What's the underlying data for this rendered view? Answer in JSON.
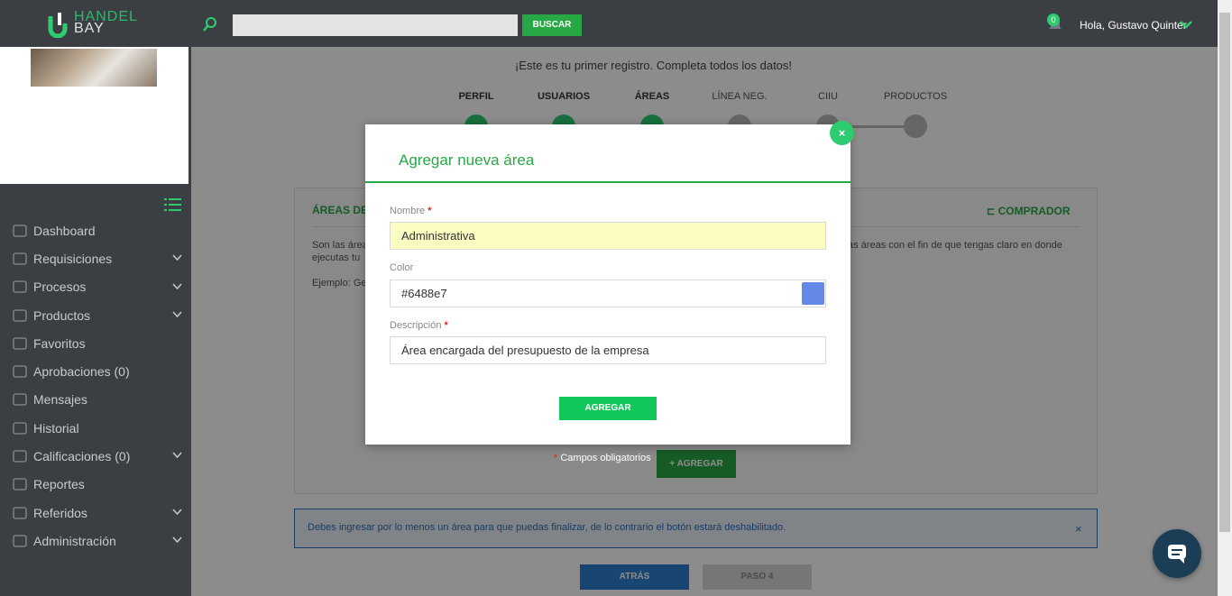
{
  "topbar": {
    "logo_text_1": "HANDEL",
    "logo_text_2": "BAY",
    "search_placeholder": "",
    "search_button": "BUSCAR",
    "notifications_count": "0",
    "greeting": "Hola, Gustavo Quinter"
  },
  "sidebar": {
    "items": [
      {
        "label": "Dashboard",
        "icon": "home-icon",
        "has_submenu": false
      },
      {
        "label": "Requisiciones",
        "icon": "clipboard-icon",
        "has_submenu": true
      },
      {
        "label": "Procesos",
        "icon": "basket-icon",
        "has_submenu": true
      },
      {
        "label": "Productos",
        "icon": "box-icon",
        "has_submenu": true
      },
      {
        "label": "Favoritos",
        "icon": "store-icon",
        "has_submenu": false
      },
      {
        "label": "Aprobaciones (0)",
        "icon": "check-icon",
        "has_submenu": false
      },
      {
        "label": "Mensajes",
        "icon": "mail-icon",
        "has_submenu": false
      },
      {
        "label": "Historial",
        "icon": "folder-icon",
        "has_submenu": false
      },
      {
        "label": "Calificaciones (0)",
        "icon": "square-icon",
        "has_submenu": true
      },
      {
        "label": "Reportes",
        "icon": "basket-icon",
        "has_submenu": false
      },
      {
        "label": "Referidos",
        "icon": "users-icon",
        "has_submenu": true
      },
      {
        "label": "Administración",
        "icon": "gear-icon",
        "has_submenu": true
      }
    ]
  },
  "wizard": {
    "intro": "¡Este es tu primer registro. Completa todos los datos!",
    "steps": [
      {
        "label": "PERFIL",
        "done": true
      },
      {
        "label": "USUARIOS",
        "done": true
      },
      {
        "label": "ÁREAS",
        "done": true
      },
      {
        "label": "LÍNEA NEG.",
        "done": false
      },
      {
        "label": "CIIU",
        "done": false
      },
      {
        "label": "PRODUCTOS",
        "done": false
      }
    ]
  },
  "card": {
    "title": "ÁREAS DE",
    "buyer_label": "COMPRADOR",
    "text_left": "Son las área",
    "text_left_2": "ejecutas tu",
    "text_right": "as áreas con el fin de que tengas claro en donde",
    "example": "Ejemplo: Ge",
    "required_note": "Campos obligatorios",
    "add_button": "AGREGAR"
  },
  "alert": {
    "text": "Debes ingresar por lo menos un área para que puedas finalizar, de lo contrario el botón estará deshabilitado.",
    "close": "×"
  },
  "footer_buttons": {
    "back": "ATRÁS",
    "step4": "PASO 4"
  },
  "modal": {
    "title": "Agregar nueva área",
    "close": "×",
    "name_label": "Nombre",
    "name_value": "Administrativa",
    "color_label": "Color",
    "color_value": "#6488e7",
    "desc_label": "Descripción",
    "desc_value": "Área encargada del presupuesto de la empresa",
    "submit": "AGREGAR"
  },
  "colors": {
    "accent": "#28a745",
    "swatch": "#6488e7",
    "dark": "#3b3f44"
  }
}
